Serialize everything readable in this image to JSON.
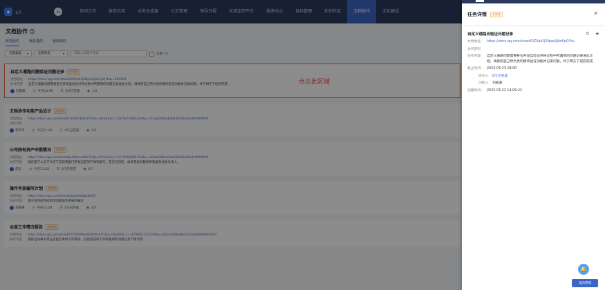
{
  "topnav": {
    "org": "1人",
    "items": [
      "协同工作",
      "表单应用",
      "业务生成器",
      "公文管理",
      "领导日程",
      "应用定制平台",
      "报表中心",
      "目标管理",
      "知识社区",
      "文档协作",
      "文化建设"
    ],
    "active_index": 9
  },
  "page": {
    "title": "文档协作",
    "help": "?",
    "tabs": [
      "我发起的",
      "我处理的",
      "我收到的"
    ],
    "active_tab": 0,
    "filters": {
      "type": "全部类型",
      "status": "全部状态",
      "search_placeholder": "请输入关键字搜索",
      "checkbox_label": "只看个人"
    }
  },
  "hint_text": "点击此区域",
  "cards": [
    {
      "title": "自定义通路问题验证问题记录",
      "badge": "未完成",
      "url_label": "文档地址",
      "url": "https://docs.qq.com/sheet/DZXp4Q2NpeUJkleFpQ?tab=000001",
      "desc_label": "协作内容",
      "desc": "自定义通路问题需要各位开发自验证并将过程中所遇到的问题记录进此文档，请按照自己所负责的模块验证功能并记录问题，并于明天下班前完成",
      "user": "刘家豪",
      "time": "今天14:09",
      "progress": "0/2已完成",
      "views": "1/2"
    },
    {
      "title": "文档协作功能产品设计",
      "badge": "未完成",
      "url_label": "文档地址",
      "url": "https://docs.qq.com/sheet/1628734630?tab=n0m61&_t=1679451401334&u=61aa2d8ba8ab43f2a5ef2ade99096df",
      "desc_label": "协作内容",
      "desc": "",
      "user": "李平平",
      "time": "今天11:30",
      "progress": "0/2已完成",
      "views": "2/2"
    },
    {
      "title": "公司固有资产申报情况",
      "badge": "未完成",
      "url_label": "文档地址",
      "url": "https://docs.qq.com/sheet/pstQkaodfnk?tab=n0m61&_t=1679451401334&u=61aa2d8ba8ab43f2a5ef2ade99096df",
      "desc_label": "协作内容",
      "desc": "请各部门人员于今天下班前将部门所有固定资产情况填写，是否已归还，如有其他问题请单独联系相关负责人。",
      "user": "庞东",
      "time": "今天11:28",
      "progress": "0/7已完成",
      "views": "0/7"
    },
    {
      "title": "操作手册编写计划",
      "badge": "未完成",
      "url_label": "文档地址",
      "url": "https://docs.qq.com/sheet/akaudn8kbdafdfj",
      "desc_label": "协作内容",
      "desc": "请于本周前完成新增功能操作手册的编写",
      "user": "刘家豪",
      "time": "今天11:24",
      "progress": "0/2已完成",
      "views": "0/2"
    },
    {
      "title": "本周工作情况报告",
      "badge": "未完成",
      "url_label": "文档地址",
      "url": "https://docs.qq.com/sheet/DT1HhWaoBE9OVUU?tab=n0m61&_t=1679451401334&u=61aa2d8ba8a3242ade8b099c6b6f",
      "desc_label": "协作内容",
      "desc": "请各位同事于周五前提交本周工作情况，包括完成的工作和遇到的问题以及下周计划",
      "user": "",
      "time": "",
      "progress": "",
      "views": ""
    }
  ],
  "panel": {
    "title": "任务详情",
    "badge": "未完成",
    "doc_title": "自定义通路自验证问题记录",
    "fields": {
      "url_label": "文档地址:",
      "url": "https://docs.qq.com/sheet/DZXp4Q2NpeUJkleFpQ?ta...",
      "pwd_label": "访问密码",
      "pwd": "",
      "desc_label": "协作内容:",
      "desc": "自定义通路问题需要各位开发自验证并将过程中所遇到的问题记录进此文档，请按照自己所负责的模块验证功能并记录问题，并于明天下班前完成",
      "deadline_label": "截止时间:",
      "deadline": "2023-03-23 18:00",
      "collab_label": "协作人:",
      "collab": "0/2已完成",
      "creator_label": "创建人:",
      "creator": "刘家豪",
      "created_label": "创建时间:",
      "created": "2023-03-22 14:09:22"
    },
    "done_button": "设为完成"
  }
}
